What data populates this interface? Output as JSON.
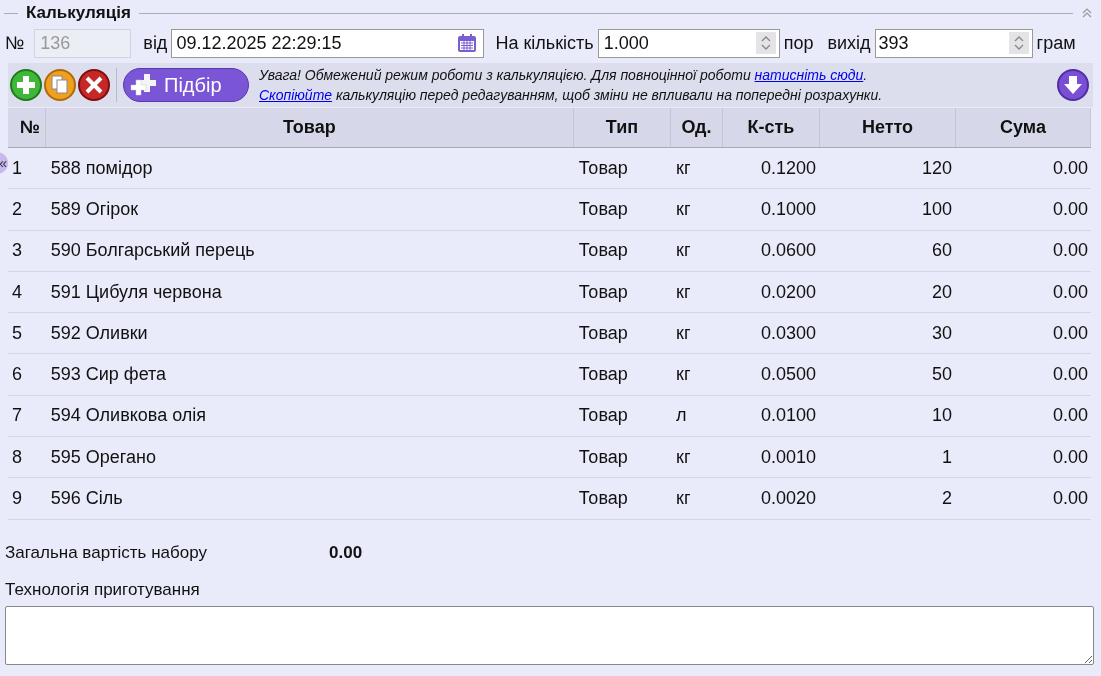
{
  "section": {
    "title": "Калькуляція"
  },
  "header": {
    "number_label": "№",
    "number": {
      "value": "136",
      "disabled": true
    },
    "date_label": "від",
    "date": "09.12.2025 22:29:15",
    "qty_label": "На кількість",
    "qty": "1.000",
    "qty_unit": "пор",
    "yield_label": "вихід",
    "yield": "393",
    "yield_unit": "грам"
  },
  "toolbar": {
    "pick_button": "Підбір",
    "notice": [
      [
        {
          "kind": "text",
          "text": "Увага! Обмежений режим роботи з калькуляцією. Для повноцінної роботи "
        },
        {
          "kind": "link",
          "text": "натисніть сюди"
        },
        {
          "kind": "text",
          "text": "."
        }
      ],
      [
        {
          "kind": "link",
          "text": "Скопіюйте"
        },
        {
          "kind": "text",
          "text": " калькуляцію перед редагуванням, щоб зміни не впливали на попередні розрахунки."
        }
      ]
    ]
  },
  "side_toggle": "«",
  "table": {
    "columns": [
      "№",
      "Товар",
      "Тип",
      "Од.",
      "К-сть",
      "Нетто",
      "Сума"
    ],
    "rows": [
      [
        "1",
        "588 помідор",
        "Товар",
        "кг",
        "0.1200",
        "120",
        "0.00"
      ],
      [
        "2",
        "589 Огірок",
        "Товар",
        "кг",
        "0.1000",
        "100",
        "0.00"
      ],
      [
        "3",
        "590 Болгарський перець",
        "Товар",
        "кг",
        "0.0600",
        "60",
        "0.00"
      ],
      [
        "4",
        "591 Цибуля червона",
        "Товар",
        "кг",
        "0.0200",
        "20",
        "0.00"
      ],
      [
        "5",
        "592 Оливки",
        "Товар",
        "кг",
        "0.0300",
        "30",
        "0.00"
      ],
      [
        "6",
        "593 Сир фета",
        "Товар",
        "кг",
        "0.0500",
        "50",
        "0.00"
      ],
      [
        "7",
        "594 Оливкова олія",
        "Товар",
        "л",
        "0.0100",
        "10",
        "0.00"
      ],
      [
        "8",
        "595 Орегано",
        "Товар",
        "кг",
        "0.0010",
        "1",
        "0.00"
      ],
      [
        "9",
        "596 Сіль",
        "Товар",
        "кг",
        "0.0020",
        "2",
        "0.00"
      ]
    ]
  },
  "total": {
    "label": "Загальна вартість набору",
    "value": "0.00"
  },
  "technology": {
    "label": "Технологія приготування"
  }
}
